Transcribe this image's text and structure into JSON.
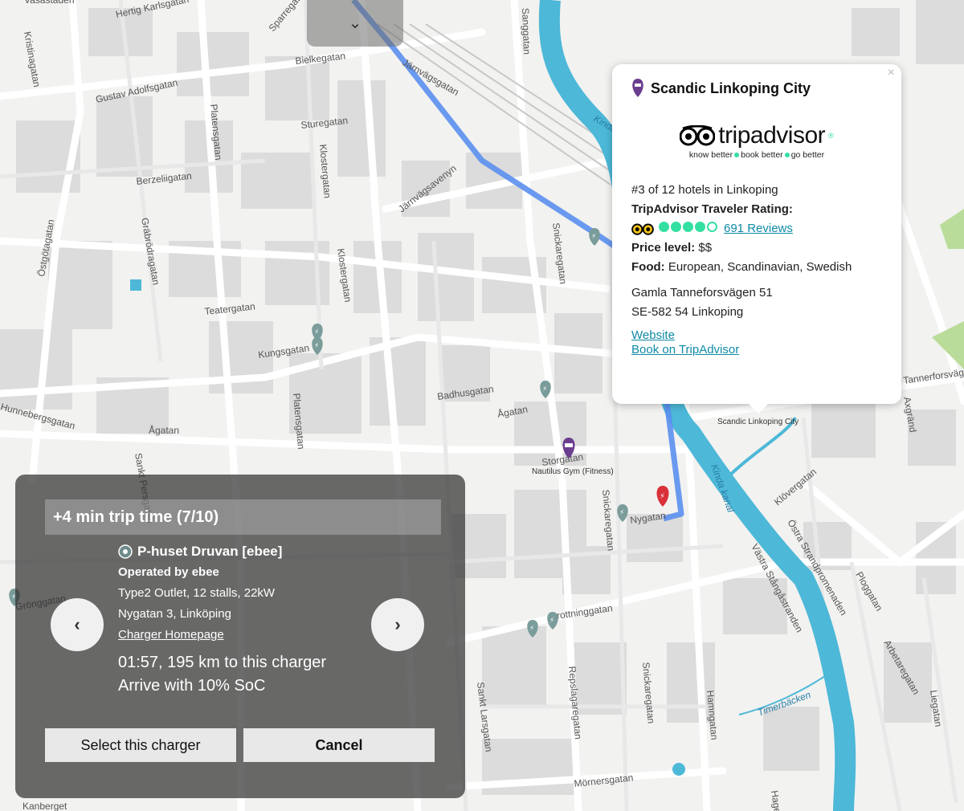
{
  "map": {
    "streets": [
      "Hertig Karlsgatan",
      "Vasastaden",
      "Sparregatan",
      "Bielkegatan",
      "Kristinagatan",
      "Gustav Adolfsgatan",
      "Platensgatan",
      "Sturegatan",
      "Klostergatan",
      "Berzeliigatan",
      "Järnvägsgatan",
      "Järnvägsavenyn",
      "Östgötagatan",
      "Gräbrödragatan",
      "Teatergatan",
      "Klostergatan",
      "Kungsgatan",
      "Snickaregatan",
      "Badhusgatan",
      "Ågatan",
      "Hunnebergsgatan",
      "Ågatan",
      "Storgatan",
      "Storgatan",
      "Snickaregatan",
      "Nygatan",
      "Nygatan",
      "Sankt Persgatan",
      "Platensgatan",
      "Drottninggatan",
      "Repslagaregatan",
      "Snickaregatan",
      "Hamngatan",
      "Mörnersgatan",
      "Sankt Larsgatan",
      "Kanberget",
      "Klövergatan",
      "Östra Strandpromenaden",
      "Västra Stångåstranden",
      "Ploggatan",
      "Arbetaregatan",
      "Liegatan",
      "Axgränd",
      "Tannerforsvägen",
      "Sanggatan",
      "Grönggatan",
      "Hagen"
    ],
    "water": [
      "Kinda kanal",
      "Timerbäcken",
      "Kinda"
    ],
    "pois": [
      "Scandic Linkoping City",
      "Nautilus Gym (Fitness)"
    ]
  },
  "popup": {
    "title": "Scandic Linkoping City",
    "close_label": "×",
    "tripadvisor_word": "tripadvisor",
    "tripadvisor_reg": "®",
    "tagline_1": "know better",
    "tagline_2": "book better",
    "tagline_3": "go better",
    "rank": "#3 of 12 hotels in Linkoping",
    "rating_label": "TripAdvisor Traveler Rating:",
    "rating_value": 4.5,
    "reviews": "691 Reviews",
    "price_label": "Price level:",
    "price_value": "$$",
    "food_label": "Food:",
    "food_value": "European, Scandinavian, Swedish",
    "address_line1": "Gamla Tanneforsvägen 51",
    "address_line2": "SE-582 54 Linkoping",
    "website_link": "Website",
    "book_link": "Book on TripAdvisor"
  },
  "charger_panel": {
    "trip_time": "+4 min trip time (7/10)",
    "name": "P-huset Druvan [ebee]",
    "operator": "Operated by ebee",
    "outlet": "Type2 Outlet, 12 stalls, 22kW",
    "address": "Nygatan 3, Linköping",
    "homepage_link": "Charger Homepage",
    "eta": "01:57, 195 km to this charger",
    "soc": "Arrive with 10% SoC",
    "select_label": "Select this charger",
    "cancel_label": "Cancel",
    "prev_icon": "‹",
    "next_icon": "›"
  },
  "collapse_icon": "⌄",
  "colors": {
    "route": "#5b8ff0",
    "water": "#4db8d8",
    "tripadvisor_green": "#34e0a1",
    "charger_pin": "#7a9c9a",
    "hotel_pin": "#6a3d8f",
    "selected_pin": "#d9303a"
  }
}
